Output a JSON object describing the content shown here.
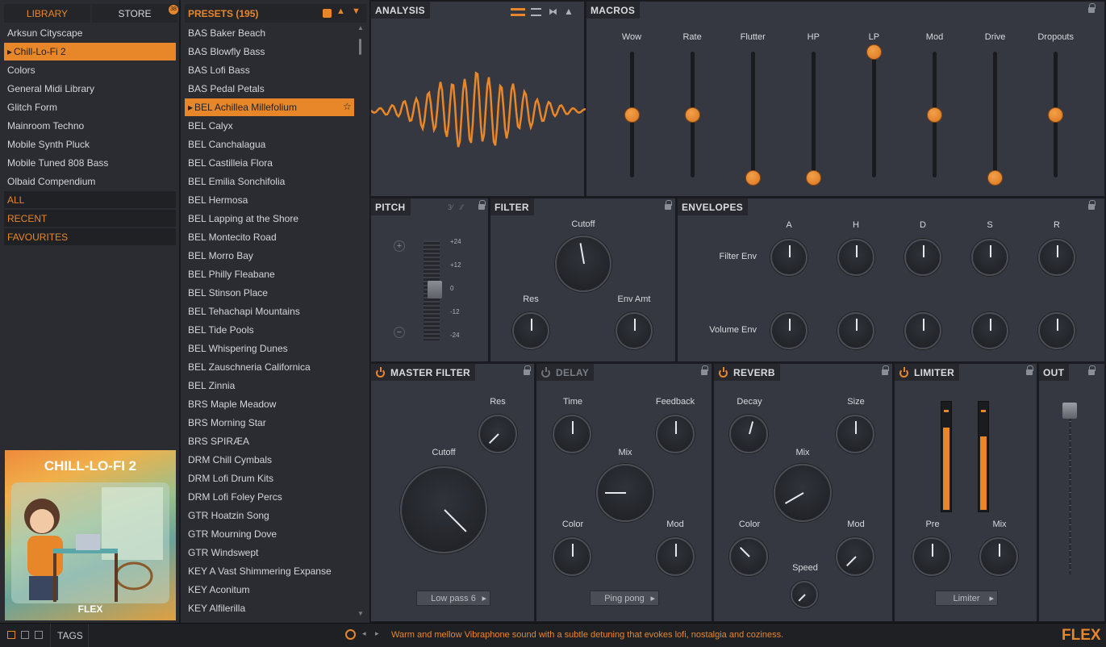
{
  "left": {
    "tabs": [
      "LIBRARY",
      "STORE"
    ],
    "store_badge": "38",
    "libraries": [
      "Arksun Cityscape",
      "Chill-Lo-Fi 2",
      "Colors",
      "General Midi Library",
      "Glitch Form",
      "Mainroom Techno",
      "Mobile Synth Pluck",
      "Mobile Tuned 808 Bass",
      "Olbaid Compendium"
    ],
    "selected_library": 1,
    "categories": [
      "ALL",
      "RECENT",
      "FAVOURITES"
    ],
    "art_title": "CHILL-LO-FI 2",
    "art_logo": "FLEX"
  },
  "presets": {
    "title": "PRESETS (195)",
    "items": [
      "BAS Baker Beach",
      "BAS Blowfly Bass",
      "BAS Lofi Bass",
      "BAS Pedal Petals",
      "BEL Achillea Millefolium",
      "BEL Calyx",
      "BEL Canchalagua",
      "BEL Castilleia Flora",
      "BEL Emilia Sonchifolia",
      "BEL Hermosa",
      "BEL Lapping at the Shore",
      "BEL Montecito Road",
      "BEL Morro Bay",
      "BEL Philly Fleabane",
      "BEL Stinson Place",
      "BEL Tehachapi Mountains",
      "BEL Tide Pools",
      "BEL Whispering Dunes",
      "BEL Zauschneria Californica",
      "BEL Zinnia",
      "BRS Maple Meadow",
      "BRS Morning Star",
      "BRS SPIRÆA",
      "DRM Chill Cymbals",
      "DRM Lofi Drum Kits",
      "DRM Lofi Foley Percs",
      "GTR Hoatzin Song",
      "GTR Mourning Dove",
      "GTR Windswept",
      "KEY A Vast Shimmering Expanse",
      "KEY Aconitum",
      "KEY Alfilerilla"
    ],
    "selected": 4
  },
  "analysis": {
    "title": "ANALYSIS"
  },
  "macros": {
    "title": "MACROS",
    "items": [
      {
        "label": "Wow",
        "value": 0.5
      },
      {
        "label": "Rate",
        "value": 0.5
      },
      {
        "label": "Flutter",
        "value": 0.0
      },
      {
        "label": "HP",
        "value": 0.0
      },
      {
        "label": "LP",
        "value": 1.0
      },
      {
        "label": "Mod",
        "value": 0.5
      },
      {
        "label": "Drive",
        "value": 0.0
      },
      {
        "label": "Dropouts",
        "value": 0.5
      }
    ]
  },
  "pitch": {
    "title": "PITCH",
    "ticks": [
      "+24",
      "+12",
      "0",
      "-12",
      "-24"
    ],
    "plus": "+",
    "minus": "−"
  },
  "filter": {
    "title": "FILTER",
    "cutoff": "Cutoff",
    "res": "Res",
    "env_amt": "Env Amt"
  },
  "envelopes": {
    "title": "ENVELOPES",
    "cols": [
      "A",
      "H",
      "D",
      "S",
      "R"
    ],
    "rows": [
      "Filter Env",
      "Volume Env"
    ]
  },
  "master_filter": {
    "title": "MASTER FILTER",
    "res": "Res",
    "cutoff": "Cutoff",
    "mode": "Low pass 6"
  },
  "delay": {
    "title": "DELAY",
    "time": "Time",
    "feedback": "Feedback",
    "mix": "Mix",
    "color": "Color",
    "mod": "Mod",
    "mode": "Ping pong"
  },
  "reverb": {
    "title": "REVERB",
    "decay": "Decay",
    "size": "Size",
    "mix": "Mix",
    "color": "Color",
    "mod": "Mod",
    "speed": "Speed"
  },
  "limiter": {
    "title": "LIMITER",
    "pre": "Pre",
    "mix": "Mix",
    "mode": "Limiter",
    "meter_levels": [
      0.78,
      0.7
    ]
  },
  "out": {
    "title": "OUT"
  },
  "status": {
    "tags": "TAGS",
    "description": "Warm and mellow Vibraphone sound with a subtle detuning that evokes lofi, nostalgia and coziness.",
    "logo": "FLEX"
  },
  "colors": {
    "accent": "#e8862a",
    "panel": "#353840",
    "bg": "#17191e"
  }
}
